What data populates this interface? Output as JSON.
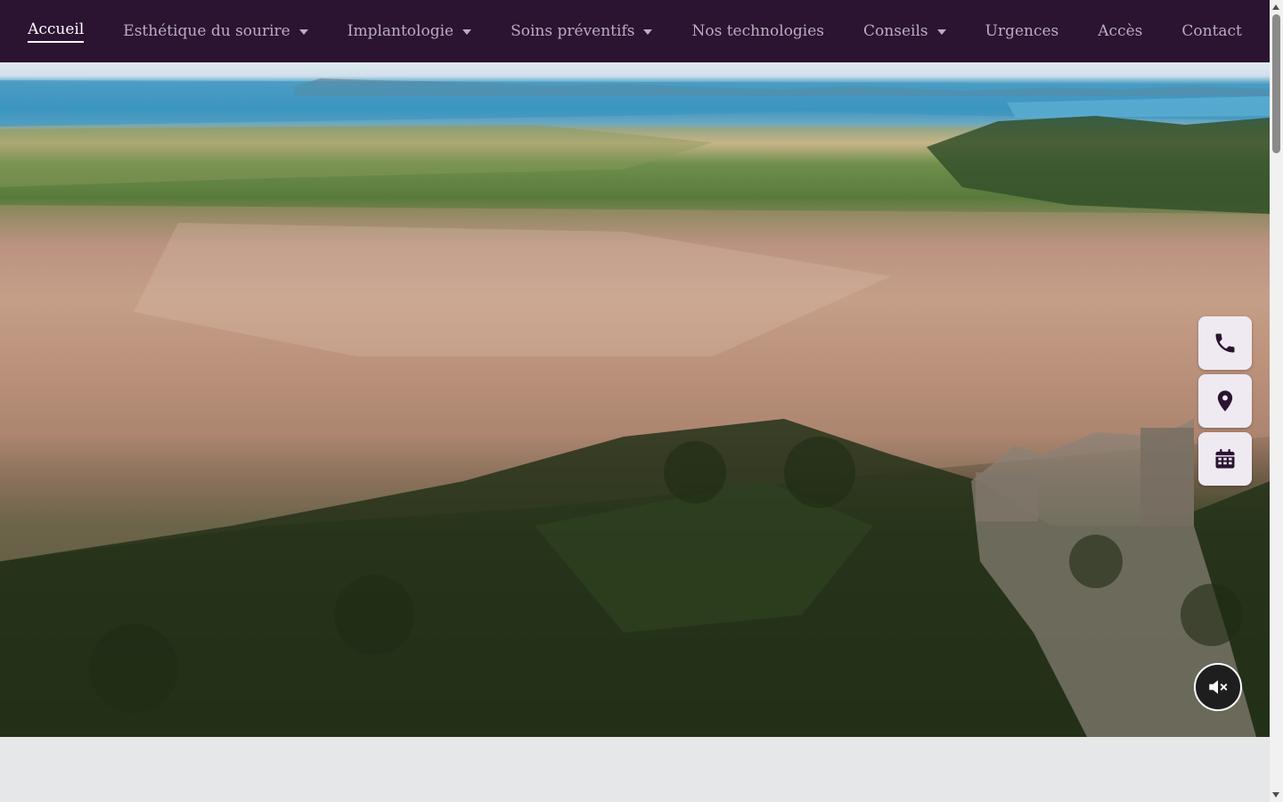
{
  "nav": {
    "items": [
      {
        "label": "Accueil",
        "dropdown": false,
        "active": true
      },
      {
        "label": "Esthétique du sourire",
        "dropdown": true,
        "active": false
      },
      {
        "label": "Implantologie",
        "dropdown": true,
        "active": false
      },
      {
        "label": "Soins préventifs",
        "dropdown": true,
        "active": false
      },
      {
        "label": "Nos technologies",
        "dropdown": false,
        "active": false
      },
      {
        "label": "Conseils",
        "dropdown": true,
        "active": false
      },
      {
        "label": "Urgences",
        "dropdown": false,
        "active": false
      },
      {
        "label": "Accès",
        "dropdown": false,
        "active": false
      },
      {
        "label": "Contact",
        "dropdown": false,
        "active": false
      }
    ]
  },
  "hero": {
    "media": "aerial-city-video"
  },
  "floating_actions": {
    "phone_icon": "phone-icon",
    "location_icon": "map-pin-icon",
    "calendar_icon": "calendar-icon"
  },
  "video_controls": {
    "mute_icon": "volume-mute-icon"
  },
  "colors": {
    "navbar_bg": "#2b1332",
    "nav_text": "#b9aebf",
    "nav_active": "#ffffff",
    "float_btn_bg": "#efe9f1",
    "icon_color": "#2b1332",
    "page_bg": "#e6e7e9"
  }
}
